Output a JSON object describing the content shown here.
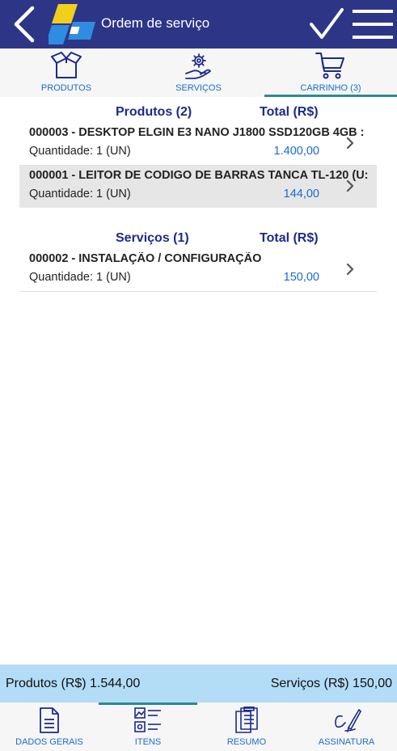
{
  "header": {
    "title": "Ordem de serviço"
  },
  "tabs": [
    {
      "label": "PRODUTOS",
      "icon": "box-icon"
    },
    {
      "label": "SERVIÇOS",
      "icon": "hand-gear-icon"
    },
    {
      "label": "CARRINHO (3)",
      "icon": "cart-icon",
      "active": true
    }
  ],
  "products": {
    "title": "Produtos (2)",
    "total_label": "Total (R$)",
    "items": [
      {
        "name": "000003 - DESKTOP ELGIN E3 NANO J1800 SSD120GB 4GB :",
        "qty": "Quantidade: 1 (UN)",
        "value": "1.400,00"
      },
      {
        "name": "000001 - LEITOR DE CODIGO DE BARRAS TANCA TL-120 (U:",
        "qty": "Quantidade: 1 (UN)",
        "value": "144,00"
      }
    ]
  },
  "services": {
    "title": "Serviços (1)",
    "total_label": "Total (R$)",
    "items": [
      {
        "name": "000002 - INSTALAÇÃO / CONFIGURAÇÃO",
        "qty": "Quantidade: 1 (UN)",
        "value": "150,00"
      }
    ]
  },
  "totals": {
    "products": "Produtos (R$) 1.544,00",
    "services": "Serviços (R$) 150,00"
  },
  "bottom_nav": [
    {
      "label": "DADOS GERAIS",
      "icon": "document-icon"
    },
    {
      "label": "ITENS",
      "icon": "items-list-icon",
      "active": true
    },
    {
      "label": "RESUMO",
      "icon": "clipboard-icon"
    },
    {
      "label": "ASSINATURA",
      "icon": "signature-pen-icon"
    }
  ],
  "colors": {
    "header": "#2d3686",
    "accent": "#1a6bd0",
    "section_title": "#1d2a8a",
    "totals_bar": "#b3dcf7",
    "active_tab": "#2a8c8c"
  }
}
